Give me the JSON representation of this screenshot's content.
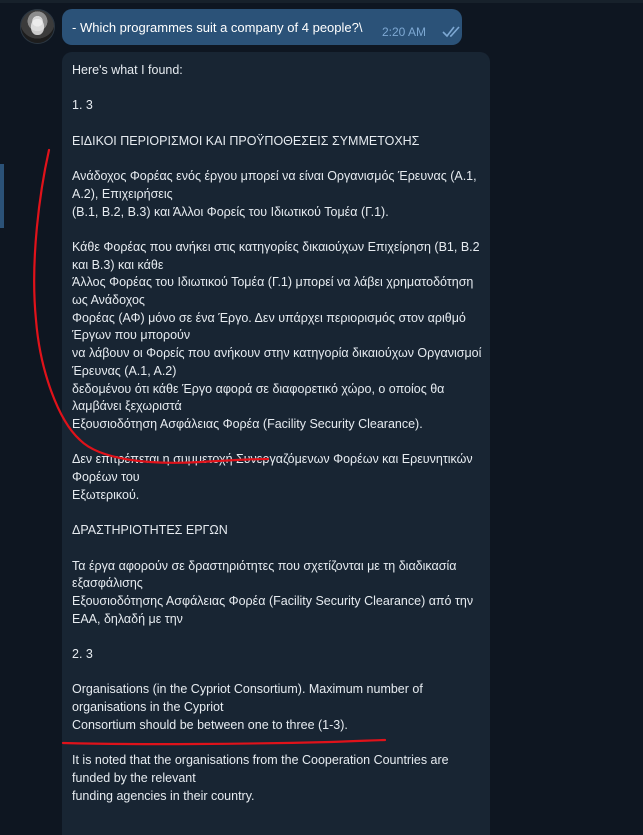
{
  "sent_message": {
    "text": "- Which programmes suit a company of 4 people?\\",
    "time": "2:20 AM",
    "status": "double-check-icon"
  },
  "reply_message": {
    "paragraphs": [
      [
        "Here's what I found:"
      ],
      [
        "1. 3"
      ],
      [
        "ΕΙΔΙΚΟΙ ΠΕΡΙΟΡΙΣΜΟΙ ΚΑΙ ΠΡΟΫΠΟΘΕΣΕΙΣ ΣΥΜΜΕΤΟΧΗΣ"
      ],
      [
        "Ανάδοχος Φορέας ενός έργου μπορεί να είναι Οργανισμός Έρευνας (Α.1, Α.2), Επιχειρήσεις",
        "(Β.1, Β.2, Β.3) και Άλλοι Φορείς του Ιδιωτικού Τομέα (Γ.1)."
      ],
      [
        "Κάθε Φορέας που ανήκει στις κατηγορίες δικαιούχων Επιχείρηση (Β1, Β.2 και Β.3) και κάθε",
        "Άλλος Φορέας του Ιδιωτικού Τομέα (Γ.1) μπορεί να λάβει χρηματοδότηση ως Ανάδοχος",
        "Φορέας (ΑΦ) μόνο σε ένα Έργο. Δεν υπάρχει περιορισμός στον αριθμό Έργων που μπορούν",
        "να λάβουν οι Φορείς που ανήκουν στην κατηγορία δικαιούχων Οργανισμοί Έρευνας (Α.1, Α.2)",
        "δεδομένου ότι κάθε Έργο αφορά σε διαφορετικό χώρο, ο οποίος θα λαμβάνει ξεχωριστά",
        "Εξουσιοδότηση Ασφάλειας Φορέα (Facility Security Clearance)."
      ],
      [
        "Δεν επιτρέπεται η συμμετοχή Συνεργαζόμενων Φορέων και Ερευνητικών Φορέων του",
        "Εξωτερικού."
      ],
      [
        "ΔΡΑΣΤΗΡΙΟΤΗΤΕΣ ΕΡΓΩΝ"
      ],
      [
        "Τα έργα αφορούν σε δραστηριότητες  που σχετίζονται με  τη διαδικασία εξασφάλισης",
        "Εξουσιοδότησης Ασφάλειας Φορέα (Facility Security Clearance) από την ΕΑΑ, δηλαδή με την"
      ],
      [
        "2. 3"
      ],
      [
        "Organisations (in the Cypriot Consortium). Maximum number of organisations in the Cypriot",
        "Consortium should be between one to three (1-3)."
      ],
      [
        "It is noted that the organisations from the Cooperation Countries are funded by the relevant",
        "funding agencies in their country."
      ]
    ]
  },
  "annotation": {
    "color": "#e0121a"
  }
}
